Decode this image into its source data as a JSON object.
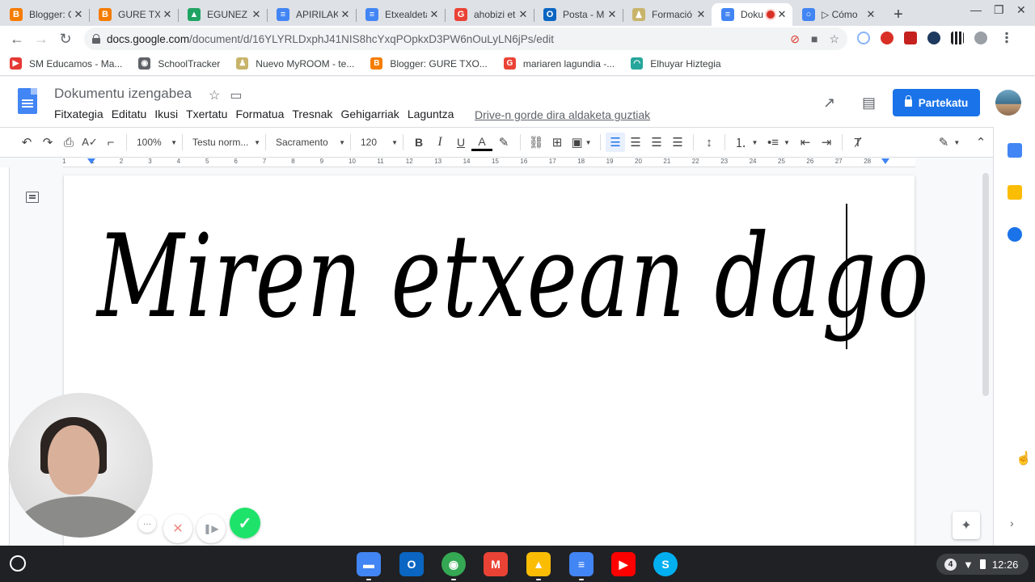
{
  "browser": {
    "tabs": [
      {
        "title": "Blogger: G",
        "color": "#f57c00",
        "glyph": "B"
      },
      {
        "title": "GURE TXO",
        "color": "#f57c00",
        "glyph": "B"
      },
      {
        "title": "EGUNEZ",
        "color": "#1fa463",
        "glyph": "▲"
      },
      {
        "title": "APIRILAK",
        "color": "#4285f4",
        "glyph": "≡"
      },
      {
        "title": "Etxealdeta",
        "color": "#4285f4",
        "glyph": "≡"
      },
      {
        "title": "ahobizi et",
        "color": "#ea4335",
        "glyph": "G"
      },
      {
        "title": "Posta - M",
        "color": "#0a66c2",
        "glyph": "O"
      },
      {
        "title": "Formació",
        "color": "#c8b46a",
        "glyph": "♟"
      },
      {
        "title": "Doku",
        "color": "#4285f4",
        "glyph": "≡"
      },
      {
        "title": "▷ Cómo",
        "color": "#4285f4",
        "glyph": "○"
      }
    ],
    "active_tab_index": 8,
    "url_host": "docs.google.com",
    "url_path": "/document/d/16YLYRLDxphJ41NIS8hcYxqPOpkxD3PW6nOuLyLN6jPs/edit",
    "bookmarks": [
      {
        "label": "SM Educamos - Ma...",
        "color": "#e53935",
        "glyph": "▶"
      },
      {
        "label": "SchoolTracker",
        "color": "#5f6368",
        "glyph": "◉"
      },
      {
        "label": "Nuevo MyROOM - te...",
        "color": "#c8b46a",
        "glyph": "♟"
      },
      {
        "label": "Blogger: GURE TXO...",
        "color": "#f57c00",
        "glyph": "B"
      },
      {
        "label": "mariaren lagundia -...",
        "color": "#ea4335",
        "glyph": "G"
      },
      {
        "label": "Elhuyar Hiztegia",
        "color": "#26a69a",
        "glyph": "◠"
      }
    ]
  },
  "docs": {
    "title": "Dokumentu izengabea",
    "menu": [
      "Fitxategia",
      "Editatu",
      "Ikusi",
      "Txertatu",
      "Formatua",
      "Tresnak",
      "Gehigarriak",
      "Laguntza"
    ],
    "save_status": "Drive-n gorde dira aldaketa guztiak",
    "share_label": "Partekatu",
    "toolbar": {
      "zoom": "100%",
      "style": "Testu norm...",
      "font": "Sacramento",
      "size": "120"
    },
    "ruler_numbers": [
      "1",
      "1",
      "2",
      "3",
      "4",
      "5",
      "6",
      "7",
      "8",
      "9",
      "10",
      "11",
      "12",
      "13",
      "14",
      "15",
      "16",
      "17",
      "18",
      "19",
      "20",
      "21",
      "22",
      "23",
      "24",
      "25",
      "26",
      "27",
      "28"
    ],
    "body_text": "Miren etxean dago",
    "colors": {
      "accent": "#1a73e8",
      "docs_blue": "#4285f4"
    }
  },
  "recorder": {
    "more_label": "···",
    "cancel_label": "✕",
    "pause_label": "❚▶",
    "confirm_label": "✓"
  },
  "shelf": {
    "apps": [
      {
        "name": "files",
        "color": "#4285f4",
        "glyph": "▬"
      },
      {
        "name": "outlook",
        "color": "#0a66c2",
        "glyph": "O"
      },
      {
        "name": "chrome",
        "color": "#34a853",
        "glyph": "◉"
      },
      {
        "name": "gmail",
        "color": "#ea4335",
        "glyph": "M"
      },
      {
        "name": "drive",
        "color": "#fbbc04",
        "glyph": "▲"
      },
      {
        "name": "docs",
        "color": "#4285f4",
        "glyph": "≡"
      },
      {
        "name": "youtube",
        "color": "#ff0000",
        "glyph": "▶"
      },
      {
        "name": "skype",
        "color": "#00aff0",
        "glyph": "S"
      }
    ],
    "notification_count": "4",
    "time": "12:26"
  }
}
